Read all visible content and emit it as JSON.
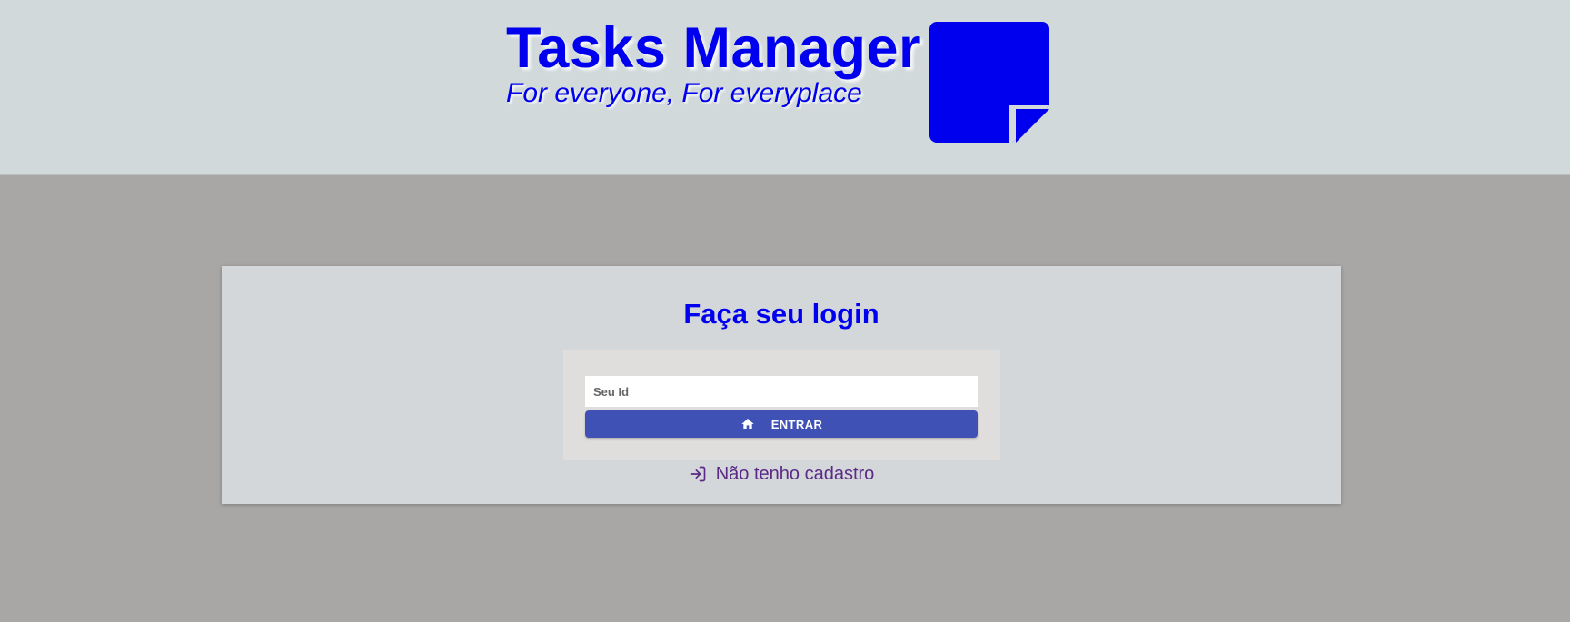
{
  "header": {
    "title": "Tasks Manager",
    "subtitle": "For everyone, For everyplace",
    "logo_icon": "sticky-note-icon",
    "brand_color": "#0000ee",
    "background": "#d1d9db"
  },
  "login": {
    "title": "Faça seu login",
    "id_input": {
      "placeholder": "Seu Id",
      "value": ""
    },
    "enter_button": {
      "icon": "home-icon",
      "label": "ENTRAR",
      "color": "#3f51b5"
    },
    "register_link": {
      "icon": "login-arrow-icon",
      "label": "Não tenho cadastro",
      "color": "#5b2a86"
    }
  },
  "page": {
    "background": "#a8a7a5"
  }
}
